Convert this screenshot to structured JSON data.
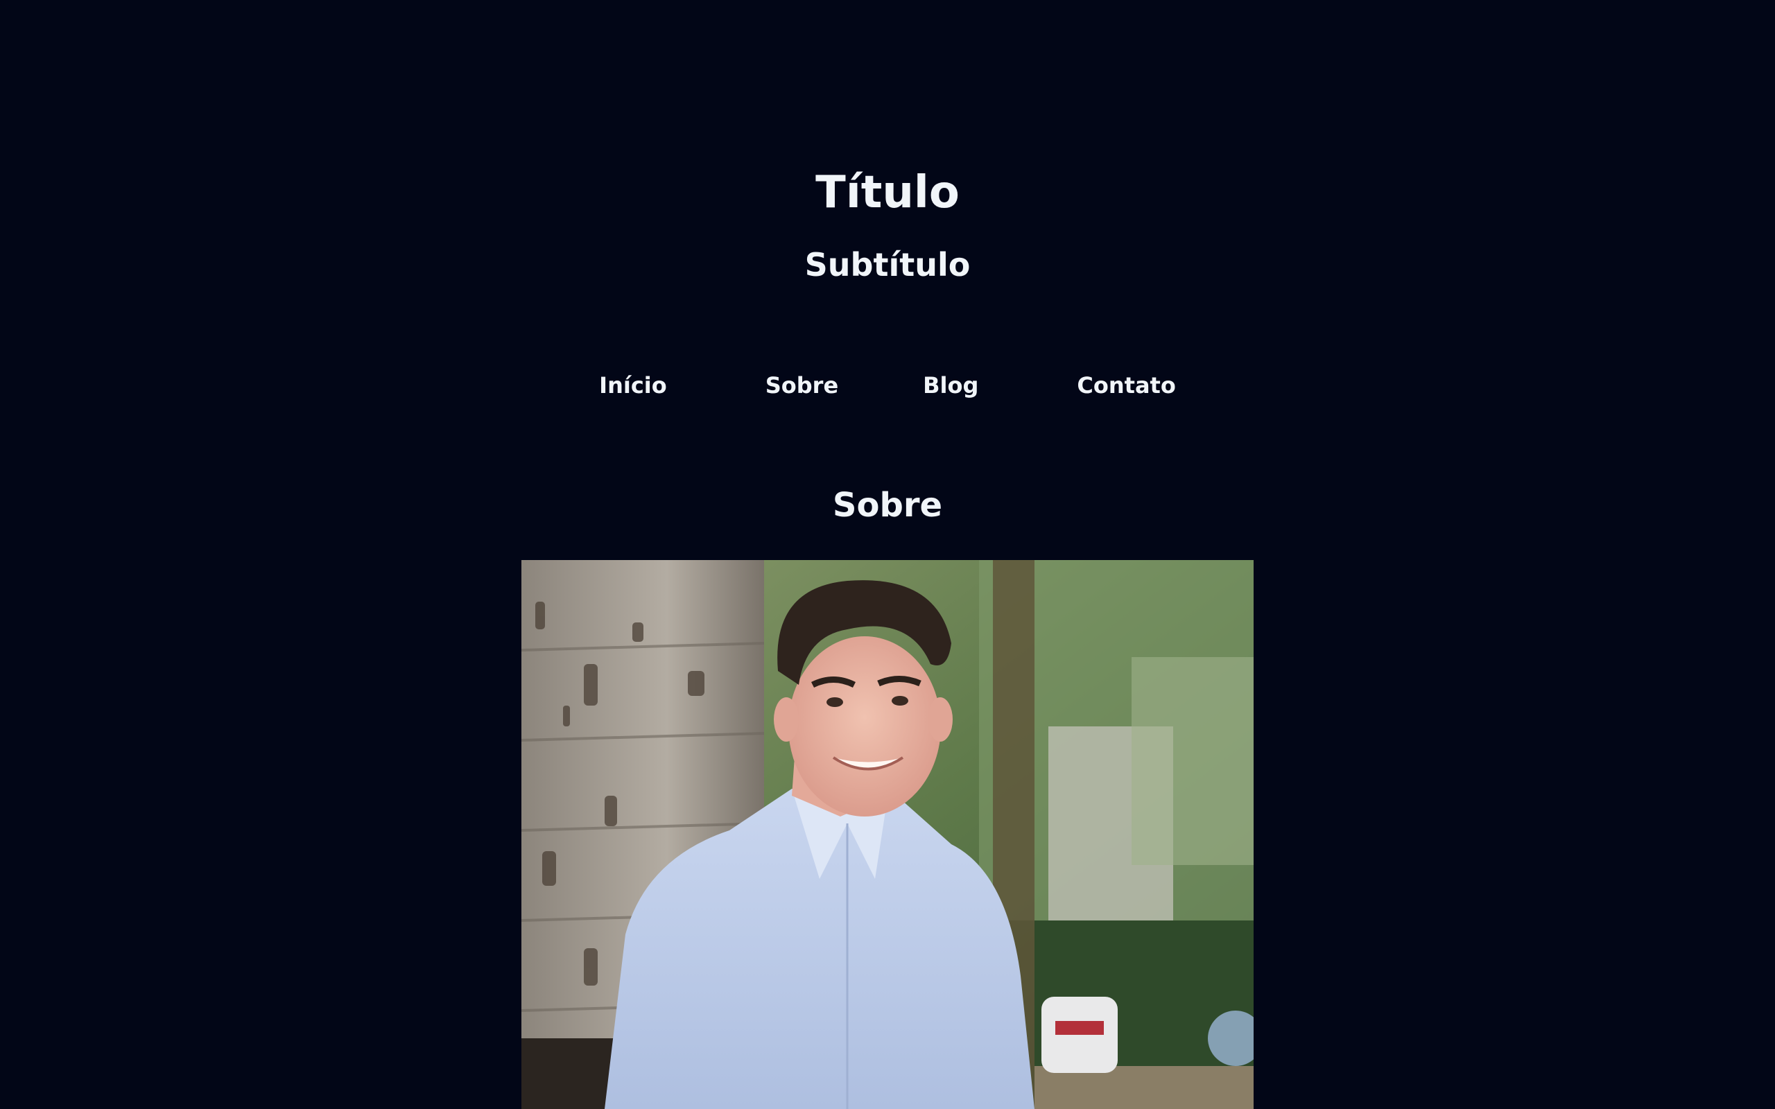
{
  "header": {
    "title": "Título",
    "subtitle": "Subtítulo"
  },
  "nav": {
    "items": [
      {
        "label": "Início"
      },
      {
        "label": "Sobre"
      },
      {
        "label": "Blog"
      },
      {
        "label": "Contato"
      }
    ]
  },
  "about": {
    "heading": "Sobre"
  },
  "colors": {
    "background": "#020617",
    "text": "#f1f5f9"
  }
}
